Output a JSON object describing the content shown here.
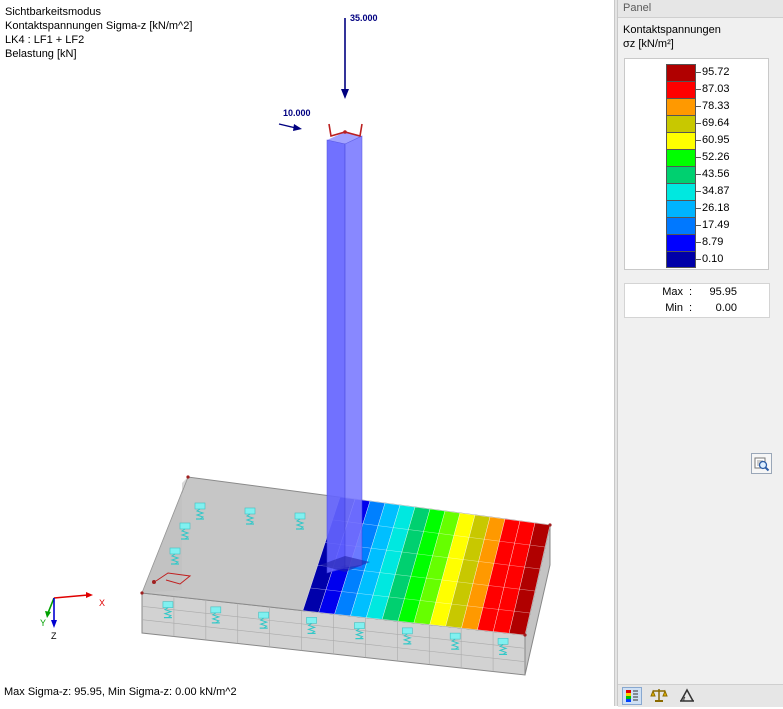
{
  "viewport": {
    "info_lines": [
      "Sichtbarkeitsmodus",
      "Kontaktspannungen Sigma-z [kN/m^2]",
      "LK4 : LF1 + LF2",
      "Belastung [kN]"
    ],
    "load_vertical": "35.000",
    "load_horizontal": "10.000",
    "status_line": "Max Sigma-z: 95.95, Min Sigma-z: 0.00 kN/m^2",
    "axes": {
      "x": "X",
      "y": "Y",
      "z": "Z"
    }
  },
  "panel": {
    "title": "Panel",
    "heading": "Kontaktspannungen",
    "unit": "σz [kN/m²]",
    "legend": [
      {
        "value": "95.72",
        "color": "#b00000"
      },
      {
        "value": "87.03",
        "color": "#ff0000"
      },
      {
        "value": "78.33",
        "color": "#ff9900"
      },
      {
        "value": "69.64",
        "color": "#c8c800"
      },
      {
        "value": "60.95",
        "color": "#ffff00"
      },
      {
        "value": "52.26",
        "color": "#00ff00"
      },
      {
        "value": "43.56",
        "color": "#00d070"
      },
      {
        "value": "34.87",
        "color": "#00e8e0"
      },
      {
        "value": "26.18",
        "color": "#00b4ff"
      },
      {
        "value": "17.49",
        "color": "#0078ff"
      },
      {
        "value": "8.79",
        "color": "#0000ff"
      },
      {
        "value": "0.10",
        "color": "#0000a8"
      }
    ],
    "max_label": "Max",
    "max_value": "95.95",
    "min_label": "Min",
    "min_value": "0.00",
    "toolbar": [
      "color-scale-icon",
      "balance-icon",
      "measure-icon"
    ]
  },
  "colors": {
    "stripes": [
      "#0000aa",
      "#0000ee",
      "#0080ff",
      "#00bfff",
      "#00e8e0",
      "#00d070",
      "#00ff00",
      "#66ff00",
      "#ffff00",
      "#c8c800",
      "#ff9900",
      "#ff0000",
      "#ff0000",
      "#b00000"
    ],
    "column": "#5555ff",
    "load": "#000080"
  }
}
